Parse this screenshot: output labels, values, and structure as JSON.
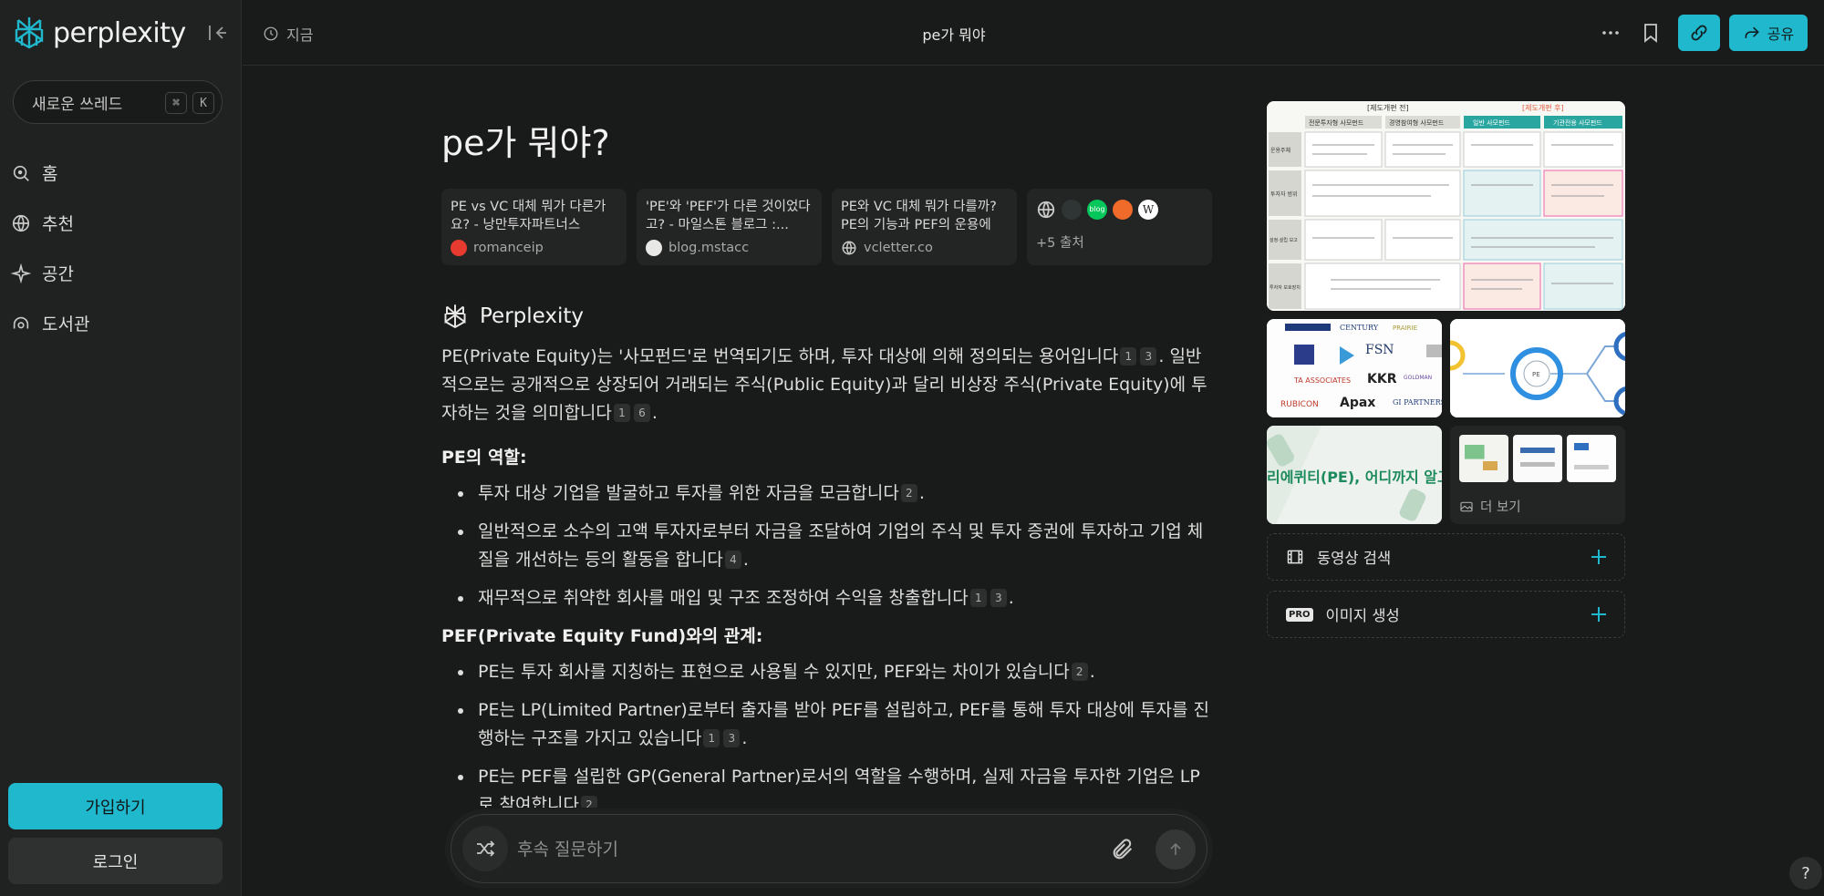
{
  "sidebar": {
    "brand": "perplexity",
    "new_thread": "새로운 쓰레드",
    "shortcut": [
      "⌘",
      "K"
    ],
    "nav": [
      {
        "label": "홈",
        "icon": "search-icon"
      },
      {
        "label": "추천",
        "icon": "globe-icon"
      },
      {
        "label": "공간",
        "icon": "sparkle-icon"
      },
      {
        "label": "도서관",
        "icon": "library-icon"
      }
    ],
    "signup": "가입하기",
    "login": "로그인"
  },
  "header": {
    "time": "지금",
    "title": "pe가 뭐야",
    "share": "공유"
  },
  "question": "pe가 뭐야?",
  "sources": [
    {
      "title": "PE vs VC 대체 뭐가 다른가요? - 낭만투자파트너스",
      "site": "romanceip",
      "fav_color": "#e63b2e"
    },
    {
      "title": "'PE'와 'PEF'가 다른 것이었다고? - 마일스톤 블로그 :...",
      "site": "blog.mstacc",
      "fav_color": "#e8e8e6"
    },
    {
      "title": "PE와 VC 대체 뭐가 다를까? PE의 기능과 PEF의 운용에 ...",
      "site": "vcletter.co",
      "fav_color": "#2a2c2c"
    }
  ],
  "more_sources": "+5 출처",
  "more_fav_labels": [
    "",
    "",
    "blog",
    "",
    "W"
  ],
  "answer": {
    "brand": "Perplexity",
    "intro_a": "PE(Private Equity)는 '사모펀드'로 번역되기도 하며, 투자 대상에 의해 정의되는 용어입니다",
    "intro_b": ". 일반적으로는 공개적으로 상장되어 거래되는 주식(Public Equity)과 달리 비상장 주식(Private Equity)에 투자하는 것을 의미합니다",
    "intro_c": ".",
    "cites_intro_1": [
      "1",
      "3"
    ],
    "cites_intro_2": [
      "1",
      "6"
    ],
    "section1_title": "PE의 역할:",
    "section1_items": [
      {
        "text": "투자 대상 기업을 발굴하고 투자를 위한 자금을 모금합니다",
        "cites": [
          "2"
        ]
      },
      {
        "text": "일반적으로 소수의 고액 투자자로부터 자금을 조달하여 기업의 주식 및 투자 증권에 투자하고 기업 체질을 개선하는 등의 활동을 합니다",
        "cites": [
          "4"
        ]
      },
      {
        "text": "재무적으로 취약한 회사를 매입 및 구조 조정하여 수익을 창출합니다",
        "cites": [
          "1",
          "3"
        ]
      }
    ],
    "section2_title": "PEF(Private Equity Fund)와의 관계:",
    "section2_items": [
      {
        "text": "PE는 투자 회사를 지칭하는 표현으로 사용될 수 있지만, PEF와는 차이가 있습니다",
        "cites": [
          "2"
        ]
      },
      {
        "text": "PE는 LP(Limited Partner)로부터 출자를 받아 PEF를 설립하고, PEF를 통해 투자 대상에 투자를 진행하는 구조를 가지고 있습니다",
        "cites": [
          "1",
          "3"
        ]
      },
      {
        "text": "PE는 PEF를 설립한 GP(General Partner)로서의 역할을 수행하며, 실제 자금을 투자한 기업은 LP로 참여합니다",
        "cites": [
          "2"
        ]
      }
    ]
  },
  "followup": {
    "placeholder": "후속 질문하기"
  },
  "right_panel": {
    "image_main": {
      "top_left": "[제도개편 전]",
      "top_right": "[제도개편 후]",
      "cols": [
        "전문투자형 사모펀드",
        "경영참여형 사모펀드",
        "일반 사모펀드",
        "기관전용 사모펀드"
      ],
      "rows": [
        "운용주체",
        "투자자 범위",
        "설정·설립 보고",
        "투자자 보호장치"
      ]
    },
    "image_logos": [
      "CENTURY",
      "FSN",
      "KKR",
      "Apax",
      "RUBICON",
      "GI PARTNERS"
    ],
    "image_banner": "리에퀴티(PE), 어디까지 알고 있니",
    "more_images": "더 보기",
    "video_search": "동영상 검색",
    "image_gen": "이미지 생성",
    "pro": "PRO"
  },
  "help": "?"
}
